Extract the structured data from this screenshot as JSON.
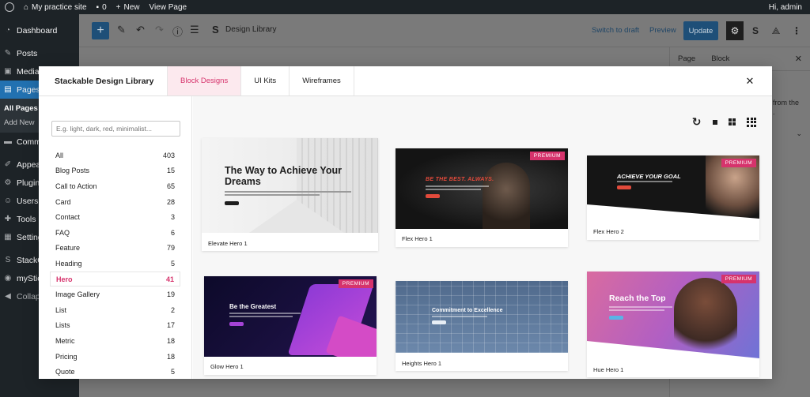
{
  "admin_bar": {
    "site_name": "My practice site",
    "comments": "0",
    "new": "New",
    "view_page": "View Page",
    "greeting": "Hi, admin"
  },
  "sidebar": {
    "items": [
      {
        "label": "Dashboard",
        "icon": "dashboard-icon"
      },
      {
        "label": "Posts",
        "icon": "pin-icon"
      },
      {
        "label": "Media",
        "icon": "media-icon"
      },
      {
        "label": "Pages",
        "icon": "pages-icon"
      },
      {
        "label": "Comm",
        "icon": "comment-icon"
      },
      {
        "label": "Appea",
        "icon": "brush-icon"
      },
      {
        "label": "Plugin",
        "icon": "plugin-icon"
      },
      {
        "label": "Users",
        "icon": "users-icon"
      },
      {
        "label": "Tools",
        "icon": "wrench-icon"
      },
      {
        "label": "Setting",
        "icon": "settings-icon"
      },
      {
        "label": "StackO",
        "icon": "stackable-icon"
      },
      {
        "label": "myStic",
        "icon": "mystick-icon"
      },
      {
        "label": "Collaps",
        "icon": "collapse-icon"
      }
    ],
    "pages_submenu": [
      "All Pages",
      "Add New"
    ]
  },
  "toolbar": {
    "library_label": "Design Library",
    "switch_to_draft": "Switch to draft",
    "preview": "Preview",
    "update": "Update"
  },
  "side_panel": {
    "tab_page": "Page",
    "tab_block": "Block",
    "peek_text_1": "from the",
    "peek_text_2": "."
  },
  "modal": {
    "title": "Stackable Design Library",
    "tabs": [
      "Block Designs",
      "UI Kits",
      "Wireframes"
    ],
    "search_placeholder": "E.g. light, dark, red, minimalist...",
    "categories": [
      {
        "name": "All",
        "count": "403"
      },
      {
        "name": "Blog Posts",
        "count": "15"
      },
      {
        "name": "Call to Action",
        "count": "65"
      },
      {
        "name": "Card",
        "count": "28"
      },
      {
        "name": "Contact",
        "count": "3"
      },
      {
        "name": "FAQ",
        "count": "6"
      },
      {
        "name": "Feature",
        "count": "79"
      },
      {
        "name": "Heading",
        "count": "5"
      },
      {
        "name": "Hero",
        "count": "41"
      },
      {
        "name": "Image Gallery",
        "count": "19"
      },
      {
        "name": "List",
        "count": "2"
      },
      {
        "name": "Lists",
        "count": "17"
      },
      {
        "name": "Metric",
        "count": "18"
      },
      {
        "name": "Pricing",
        "count": "18"
      },
      {
        "name": "Quote",
        "count": "5"
      }
    ],
    "cards": [
      {
        "name": "Elevate Hero 1",
        "headline": "The Way to Achieve Your Dreams",
        "premium": ""
      },
      {
        "name": "Flex Hero 1",
        "headline": "BE THE BEST. ALWAYS.",
        "premium": "PREMIUM"
      },
      {
        "name": "Flex Hero 2",
        "headline": "ACHIEVE YOUR GOAL",
        "premium": "PREMIUM"
      },
      {
        "name": "Glow Hero 1",
        "headline": "Be the Greatest",
        "premium": "PREMIUM"
      },
      {
        "name": "Heights Hero 1",
        "headline": "Commitment to Excellence",
        "premium": ""
      },
      {
        "name": "Hue Hero 1",
        "headline": "Reach the Top",
        "premium": "PREMIUM"
      }
    ]
  },
  "colors": {
    "accent": "#d6336c",
    "wp_blue": "#2271b1",
    "admin_dark": "#1d2327"
  }
}
